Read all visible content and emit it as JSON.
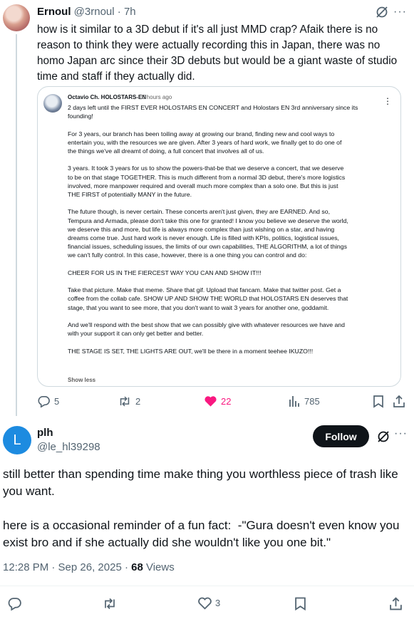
{
  "parent_tweet": {
    "author_name": "Ernoul",
    "handle": "@3rnoul",
    "separator": "·",
    "time": "7h",
    "text": "how is it similar to a 3D debut if it's all just MMD crap? Afaik there is no reason to think they were actually recording this in Japan, there was no homo Japan arc since their 3D debuts but would be a giant waste of studio time and staff if they actually did.",
    "quote": {
      "author": "Octavio Ch. HOLOSTARS-EN",
      "time": "5 hours ago",
      "body": "2 days left until the FIRST EVER HOLOSTARS EN CONCERT and Holostars EN 3rd anniversary since its\nfounding!\n\nFor 3 years, our branch has been toiling away at growing our brand, finding new and cool ways to\nentertain you, with the resources we are given. After 3 years of hard work, we finally get to do one of\nthe things we've all dreamt of doing, a full concert that involves all of us.\n\n3 years. It took 3 years for us to show the powers-that-be that we deserve a concert, that we deserve\nto be on that stage TOGETHER. This is much different from a normal 3D debut, there's more logistics\ninvolved, more manpower required and overall much more complex than a solo one. But this is just\nTHE FIRST of potentially MANY in the future.\n\nThe future though, is never certain. These concerts aren't just given, they are EARNED. And so,\nTempura and Armada, please don't take this one for granted! I know you believe we deserve the world,\nwe deserve this and more, but life is always more complex than just wishing on a star, and having\ndreams come true. Just hard work is never enough. Life is filled with KPIs, politics, logistical issues,\nfinancial issues, scheduling issues, the limits of our own capabilities, THE ALGORITHM, a lot of things\nwe can't fully control. In this case, however, there is a one thing you can control and do:\n\nCHEER FOR US IN THE FIERCEST WAY YOU CAN AND SHOW IT!!!\n\nTake that picture. Make that meme. Share that gif. Upload that fancam. Make that twitter post. Get a\ncoffee from the collab cafe. SHOW UP AND SHOW THE WORLD that HOLOSTARS EN deserves that\nstage, that you want to see more, that you don't want to wait 3 years for another one, goddamit.\n\nAnd we'll respond with the best show that we can possibly give with whatever resources we have and\nwith your support it can only get better and better.\n\nTHE STAGE IS SET, THE LIGHTS ARE OUT, we'll be there in a moment teehee IKUZO!!!",
      "show_less": "Show less"
    },
    "stats": {
      "replies": "5",
      "reposts": "2",
      "likes": "22",
      "views": "785"
    }
  },
  "main_tweet": {
    "avatar_letter": "L",
    "author_name": "plh",
    "handle": "@le_hl39298",
    "follow_label": "Follow",
    "text": "still better than spending time make thing you worthless piece of trash like you want.\n\nhere is a occasional reminder of a fun fact:  -\"Gura doesn't even know you exist bro and if she actually did she wouldn't like you one bit.\"",
    "timestamp": "12:28 PM · Sep 26, 2025 · ",
    "view_count": "68",
    "views_label": " Views",
    "stats": {
      "likes": "3"
    }
  },
  "colors": {
    "like_active": "#f91880",
    "icon_grey": "#536471",
    "text": "#0f1419",
    "avatar_blue": "#1d8be0"
  }
}
